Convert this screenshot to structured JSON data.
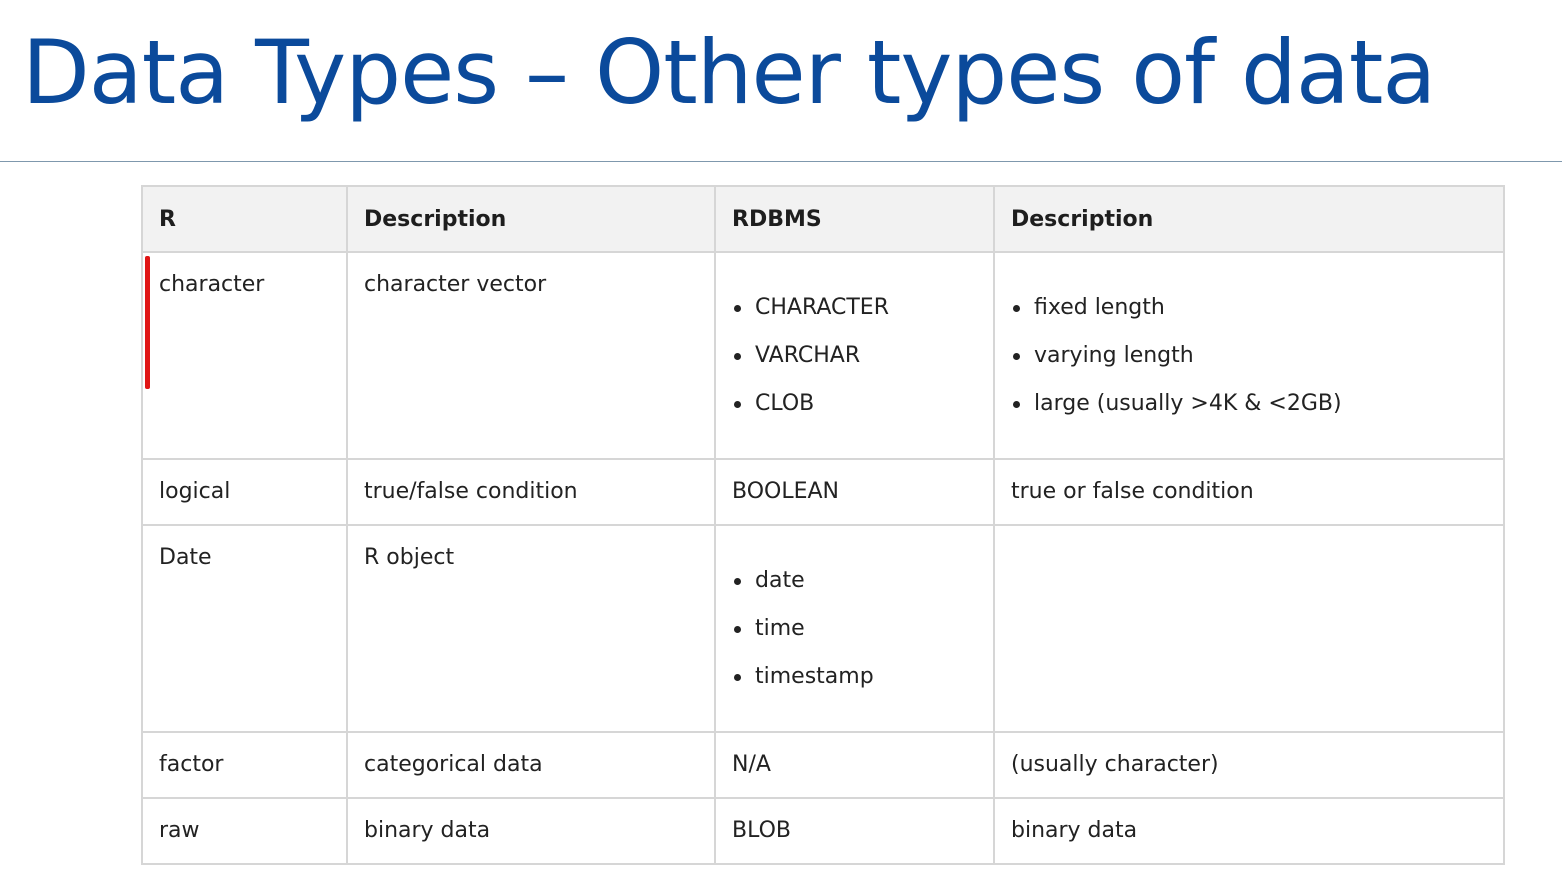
{
  "slide": {
    "title": "Data Types – Other types of data"
  },
  "table": {
    "headers": [
      "R",
      "Description",
      "RDBMS",
      "Description"
    ],
    "rows": [
      {
        "r": "character",
        "description": "character vector",
        "rdbms_list": [
          "CHARACTER",
          "VARCHAR",
          "CLOB"
        ],
        "rdbms_description_list": [
          "fixed length",
          "varying length",
          "large (usually >4K & <2GB)"
        ]
      },
      {
        "r": "logical",
        "description": "true/false condition",
        "rdbms": "BOOLEAN",
        "rdbms_description": "true or false condition"
      },
      {
        "r": "Date",
        "description": "R object",
        "rdbms_list": [
          "date",
          "time",
          "timestamp"
        ],
        "rdbms_description": ""
      },
      {
        "r": "factor",
        "description": "categorical data",
        "rdbms": "N/A",
        "rdbms_description": "(usually character)"
      },
      {
        "r": "raw",
        "description": "binary data",
        "rdbms": "BLOB",
        "rdbms_description": "binary data"
      }
    ]
  },
  "colors": {
    "title": "#0b4a9b",
    "marker": "#e01515",
    "header_bg": "#f2f2f2",
    "border": "#d6d6d6"
  }
}
